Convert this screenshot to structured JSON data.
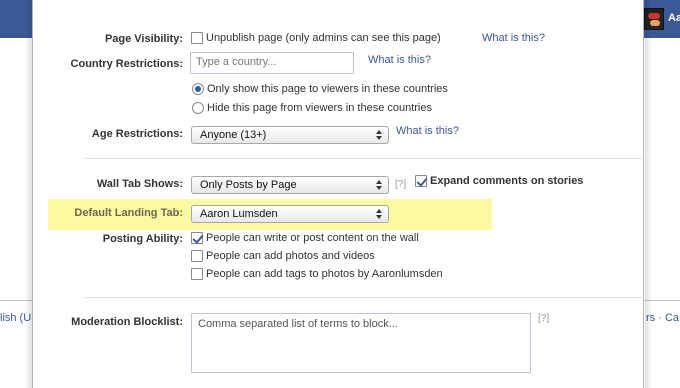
{
  "background": {
    "profile_name": "Aa",
    "footer_left": "lish (US",
    "footer_right": "rs · Ca"
  },
  "colors": {
    "link": "#3b5998",
    "highlight": "#fbf9a2",
    "facebook_blue": "#3b5998"
  },
  "settings": {
    "page_visibility": {
      "label": "Page Visibility:",
      "option": "Unpublish page (only admins can see this page)",
      "checked": false,
      "help_link": "What is this?"
    },
    "country_restrictions": {
      "label": "Country Restrictions:",
      "placeholder": "Type a country...",
      "help_link": "What is this?",
      "options": [
        {
          "label": "Only show this page to viewers in these countries",
          "selected": true
        },
        {
          "label": "Hide this page from viewers in these countries",
          "selected": false
        }
      ]
    },
    "age_restrictions": {
      "label": "Age Restrictions:",
      "value": "Anyone (13+)",
      "help_link": "What is this?"
    },
    "wall_tab_shows": {
      "label": "Wall Tab Shows:",
      "value": "Only Posts by Page",
      "help": "[?]",
      "expand_comments": {
        "label": "Expand comments on stories",
        "checked": true
      }
    },
    "default_landing_tab": {
      "label": "Default Landing Tab:",
      "value": "Aaron Lumsden"
    },
    "posting_ability": {
      "label": "Posting Ability:",
      "options": [
        {
          "label": "People can write or post content on the wall",
          "checked": true
        },
        {
          "label": "People can add photos and videos",
          "checked": false
        },
        {
          "label": "People can add tags to photos by Aaronlumsden",
          "checked": false
        }
      ]
    },
    "moderation_blocklist": {
      "label": "Moderation Blocklist:",
      "placeholder": "Comma separated list of terms to block...",
      "help": "[?]"
    }
  }
}
